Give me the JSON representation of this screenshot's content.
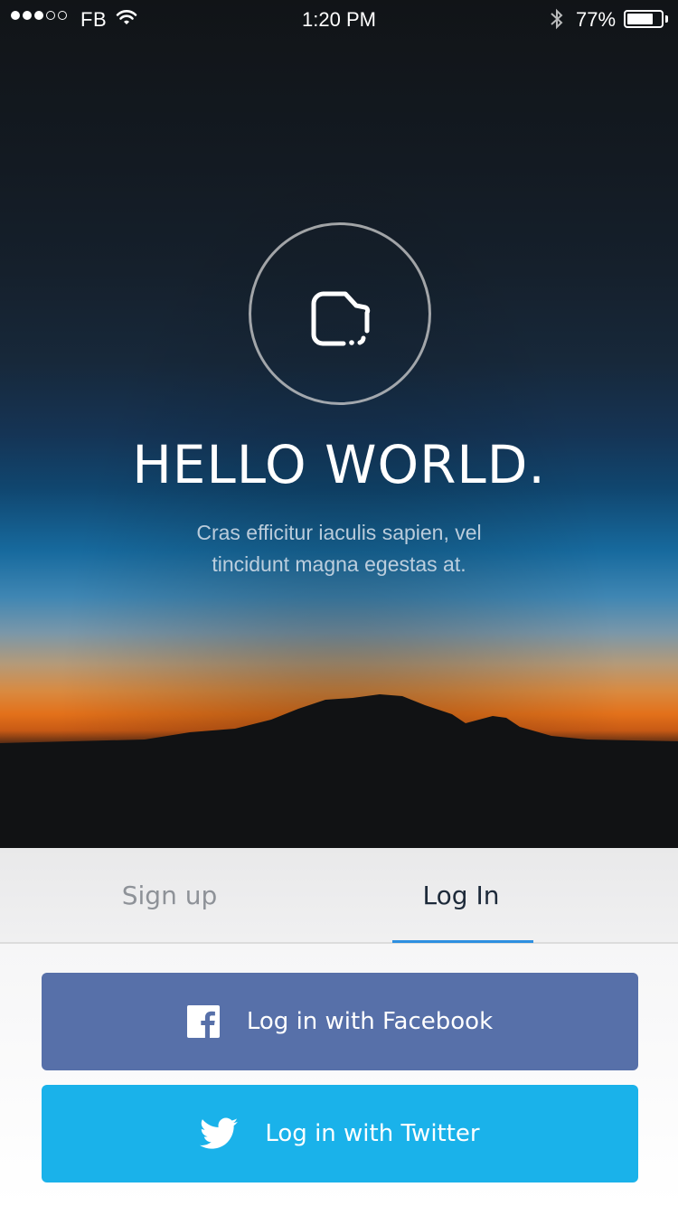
{
  "status_bar": {
    "carrier": "FB",
    "time": "1:20 PM",
    "battery_percent": "77%",
    "battery_level": 0.77,
    "signal_bars_filled": 3,
    "signal_bars_total": 5
  },
  "hero": {
    "logo_icon": "logo-icon",
    "title": "HELLO WORLD.",
    "subtitle_line1": "Cras efficitur iaculis sapien, vel",
    "subtitle_line2": "tincidunt magna egestas at."
  },
  "tabs": {
    "items": [
      {
        "label": "Sign up",
        "active": false
      },
      {
        "label": "Log In",
        "active": true
      }
    ],
    "accent_color": "#2d8fe0"
  },
  "buttons": {
    "facebook": {
      "label": "Log in with Facebook",
      "icon": "facebook-icon",
      "color": "#5770a9"
    },
    "twitter": {
      "label": "Log in with Twitter",
      "icon": "twitter-icon",
      "color": "#1ab2ea"
    }
  }
}
